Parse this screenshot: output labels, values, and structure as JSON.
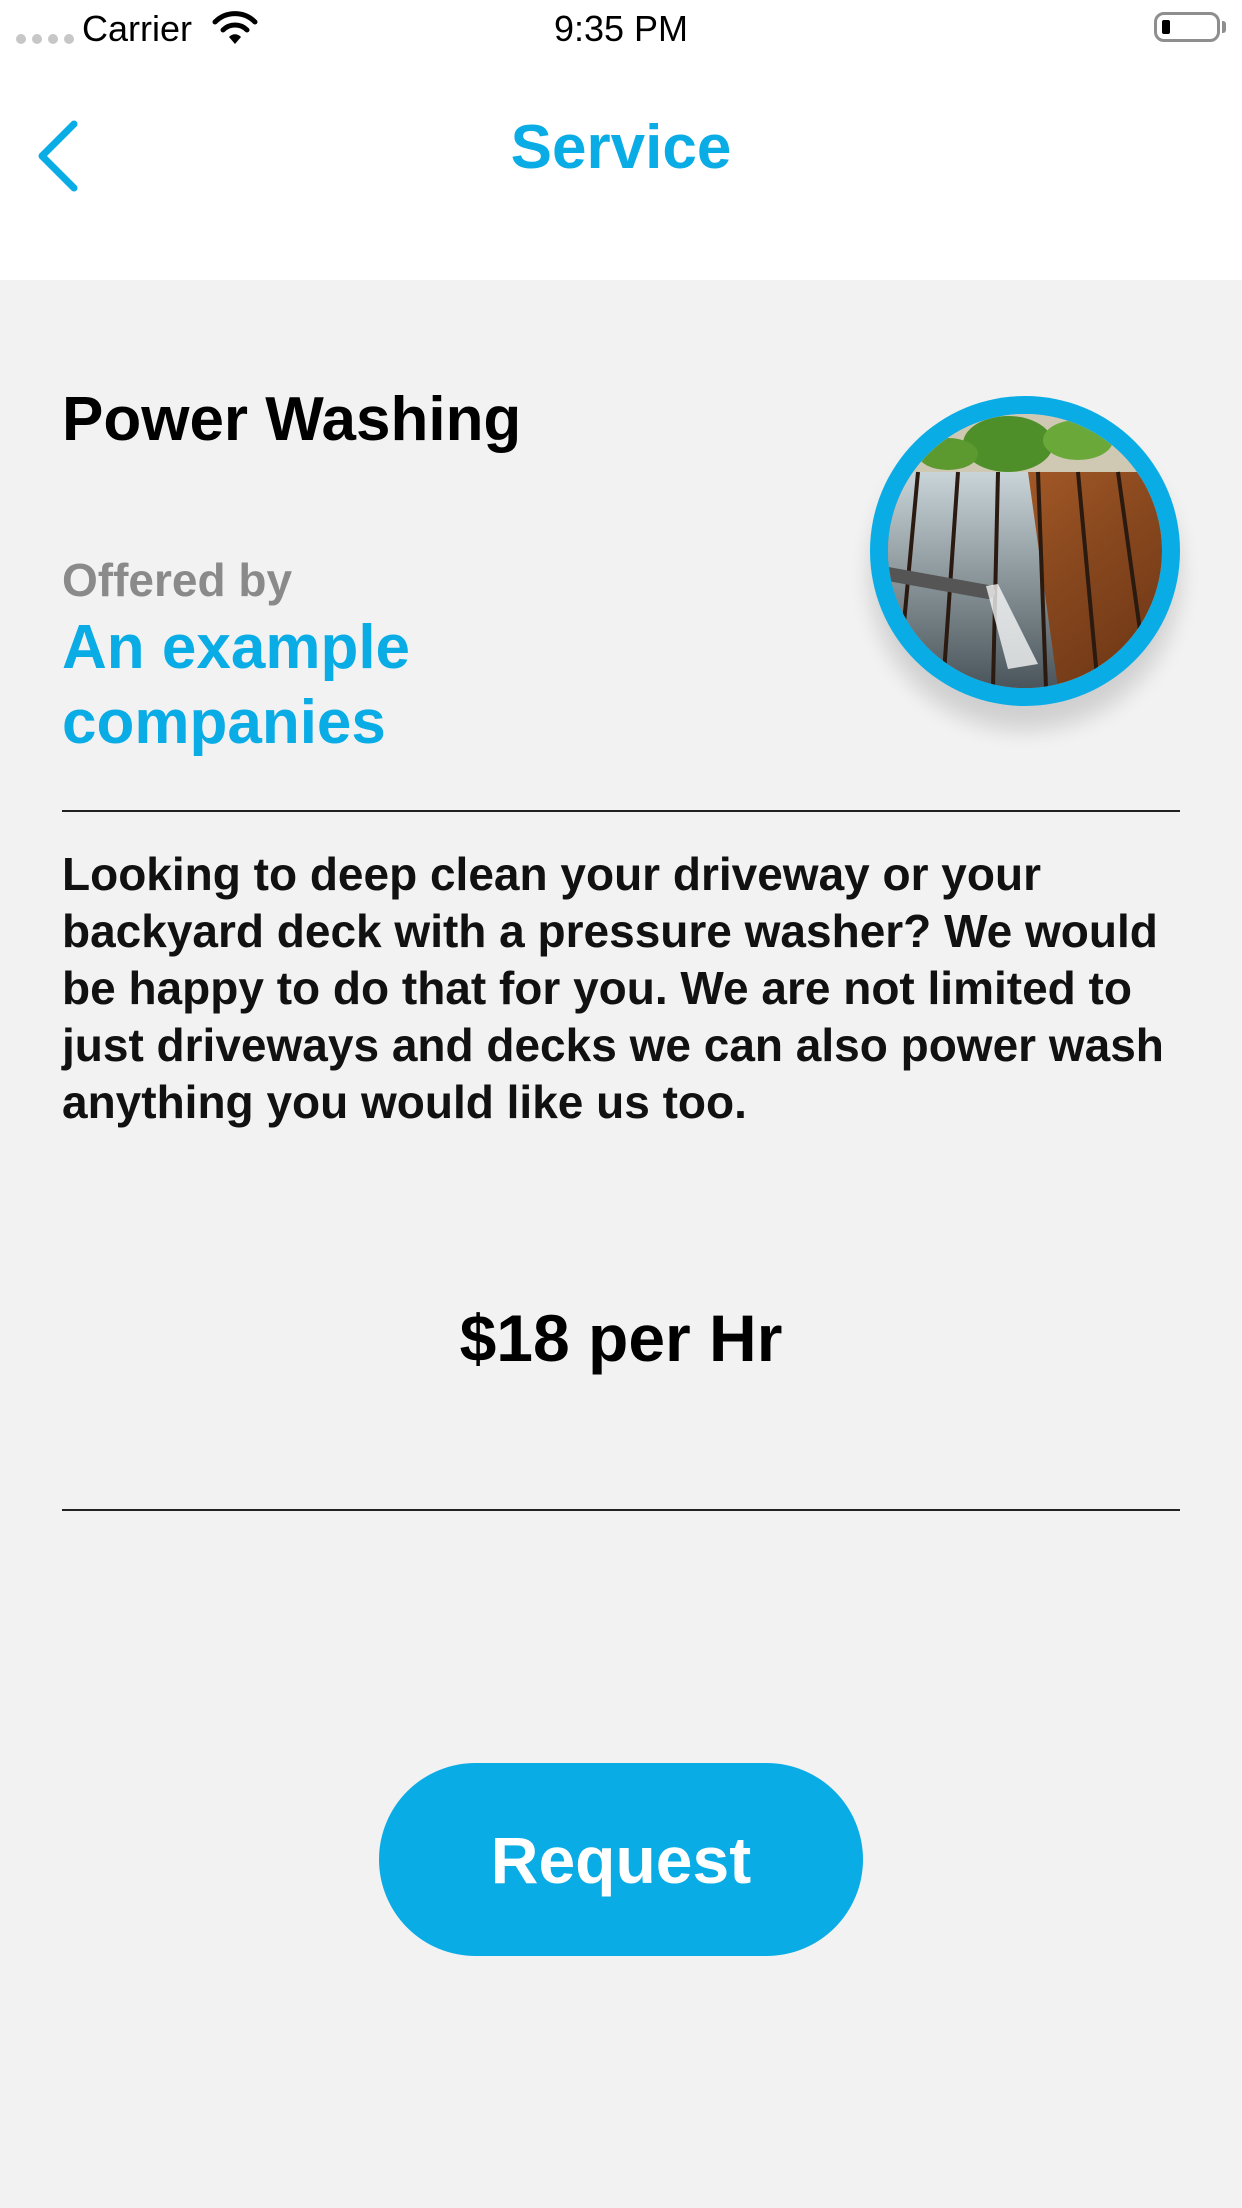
{
  "status_bar": {
    "carrier": "Carrier",
    "time": "9:35 PM",
    "battery_level": 0.1
  },
  "nav": {
    "title": "Service",
    "back_icon": "chevron-left-icon"
  },
  "service": {
    "title": "Power Washing",
    "offered_by_label": "Offered by",
    "company": "An example companies",
    "image": "power-washing-deck-photo",
    "description": "Looking to deep clean your driveway or your backyard deck with a pressure washer? We would be happy to do that for you. We are not limited to just driveways and decks we can also power wash anything you would like us too.",
    "price": "$18 per Hr"
  },
  "actions": {
    "request_label": "Request"
  },
  "colors": {
    "accent": "#0aace6",
    "background": "#f2f2f2",
    "muted_text": "#8a8a8a"
  }
}
